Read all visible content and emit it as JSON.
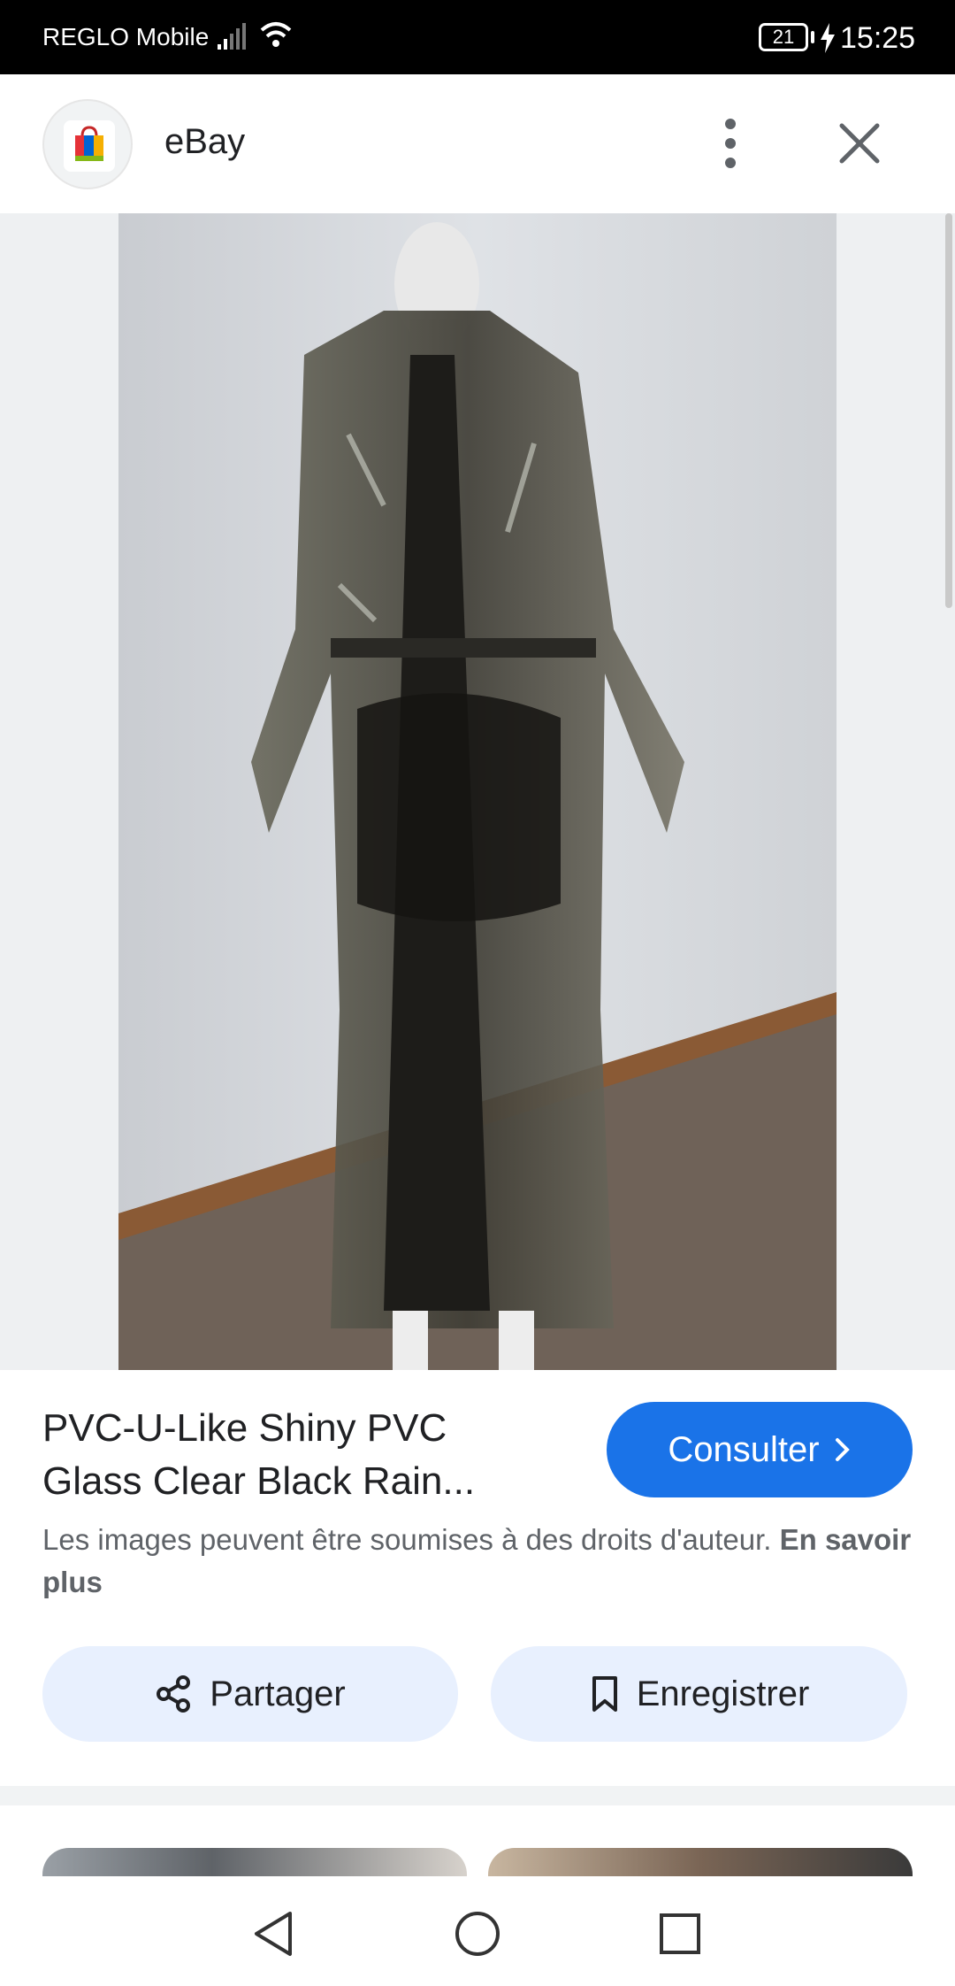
{
  "status_bar": {
    "carrier": "REGLO Mobile",
    "battery": "21",
    "time": "15:25"
  },
  "header": {
    "site_name": "eBay"
  },
  "product": {
    "title": "PVC-U-Like Shiny PVC Glass Clear Black Rain...",
    "consult_label": "Consulter"
  },
  "copyright": {
    "text": "Les images peuvent être soumises à des droits d'auteur.",
    "link": "En savoir plus"
  },
  "actions": {
    "share_label": "Partager",
    "save_label": "Enregistrer"
  },
  "colors": {
    "accent": "#1a73e8",
    "chip_bg": "#e8f0fe",
    "status_bg": "#000000"
  },
  "icons": [
    "signal-icon",
    "wifi-icon",
    "battery-icon",
    "charging-icon",
    "more-vert-icon",
    "close-icon",
    "lens-icon",
    "chevron-right-icon",
    "share-icon",
    "bookmark-icon",
    "nav-back-icon",
    "nav-home-icon",
    "nav-recents-icon"
  ]
}
